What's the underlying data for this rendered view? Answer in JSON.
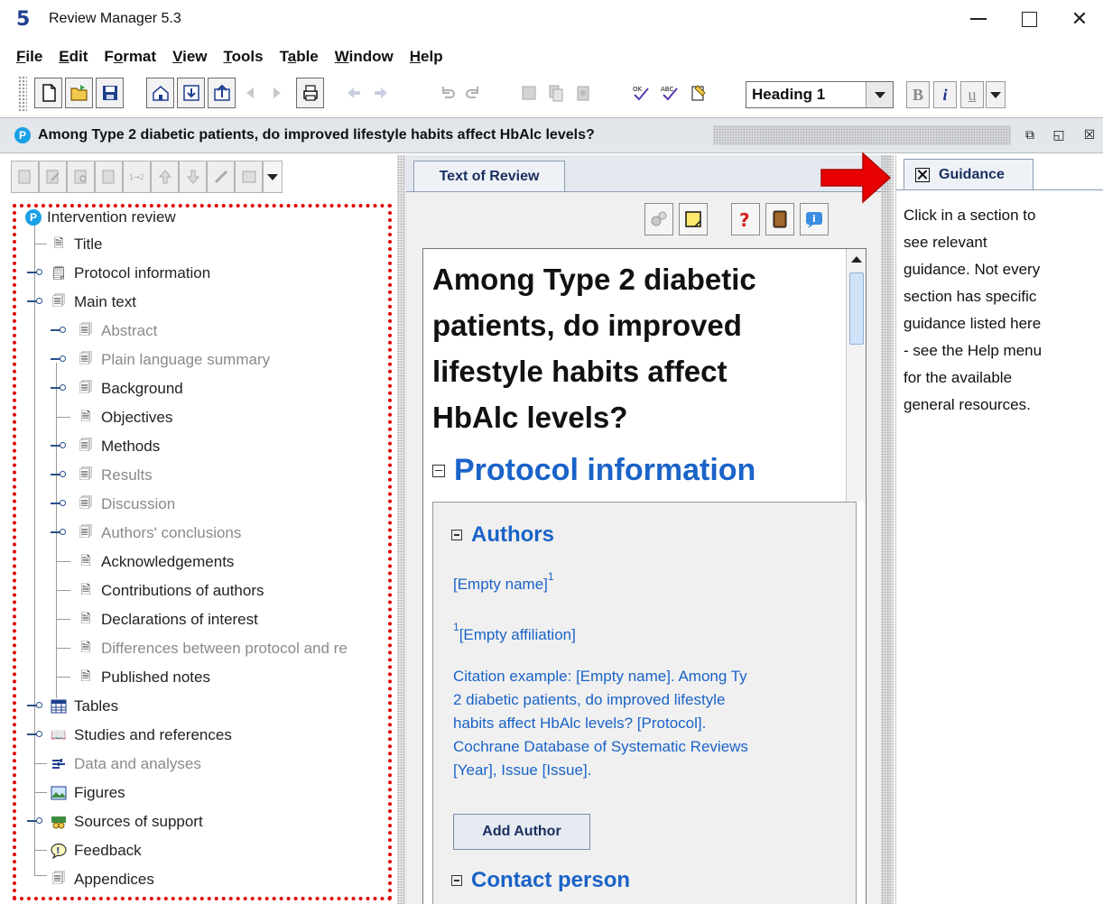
{
  "window": {
    "logo": "5",
    "title": "Review Manager 5.3"
  },
  "menu": [
    {
      "mnemonic": "F",
      "rest": "ile"
    },
    {
      "mnemonic": "E",
      "rest": "dit"
    },
    {
      "pre": "F",
      "mnemonic": "o",
      "rest": "rmat"
    },
    {
      "mnemonic": "V",
      "rest": "iew"
    },
    {
      "mnemonic": "T",
      "rest": "ools"
    },
    {
      "pre": "T",
      "mnemonic": "a",
      "rest": "ble"
    },
    {
      "mnemonic": "W",
      "rest": "indow"
    },
    {
      "mnemonic": "H",
      "rest": "elp"
    }
  ],
  "toolbar": {
    "style_select": "Heading 1",
    "bold": "B",
    "italic": "i",
    "underline": "u"
  },
  "document": {
    "title": "Among Type 2 diabetic patients, do improved lifestyle habits affect HbAlc levels?"
  },
  "tree": {
    "root": "Intervention review",
    "items": [
      {
        "label": "Title"
      },
      {
        "label": "Protocol information"
      },
      {
        "label": "Main text"
      },
      {
        "label": "Abstract"
      },
      {
        "label": "Plain language summary"
      },
      {
        "label": "Background"
      },
      {
        "label": "Objectives"
      },
      {
        "label": "Methods"
      },
      {
        "label": "Results"
      },
      {
        "label": "Discussion"
      },
      {
        "label": "Authors' conclusions"
      },
      {
        "label": "Acknowledgements"
      },
      {
        "label": "Contributions of authors"
      },
      {
        "label": "Declarations of interest"
      },
      {
        "label": "Differences between protocol and re"
      },
      {
        "label": "Published notes"
      },
      {
        "label": "Tables"
      },
      {
        "label": "Studies and references"
      },
      {
        "label": "Data and analyses"
      },
      {
        "label": "Figures"
      },
      {
        "label": "Sources of support"
      },
      {
        "label": "Feedback"
      },
      {
        "label": "Appendices"
      }
    ]
  },
  "editor": {
    "tab": "Text of Review",
    "heading_lines": [
      "Among Type 2 diabetic",
      "patients, do improved",
      "lifestyle habits affect",
      "HbAlc levels?"
    ],
    "section": "Protocol information",
    "authors_heading": "Authors",
    "empty_name": "[Empty name]",
    "sup1": "1",
    "sup2": "1",
    "empty_affiliation": "[Empty affiliation]",
    "citation_lines": [
      "Citation example: [Empty name]. Among Ty",
      "2 diabetic patients, do improved lifestyle",
      "habits affect HbAlc levels? [Protocol].",
      "Cochrane Database of Systematic Reviews",
      "[Year], Issue [Issue]."
    ],
    "add_author": "Add Author",
    "contact_heading": "Contact person"
  },
  "guidance": {
    "tab": "Guidance",
    "lines": [
      "Click in a section to",
      "see relevant",
      "guidance. Not every",
      "section has specific",
      "guidance listed here",
      "- see the Help menu",
      "for the available",
      "general resources."
    ]
  },
  "colors": {
    "link_blue": "#1a63c8",
    "highlight_red": "#e00000"
  }
}
